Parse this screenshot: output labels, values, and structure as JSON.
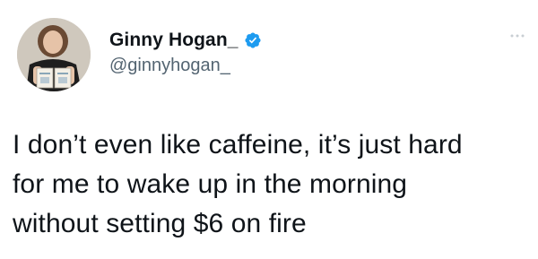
{
  "tweet": {
    "display_name": "Ginny Hogan_",
    "handle": "@ginnyhogan_",
    "verified": true,
    "text": "I don’t even like caffeine, it’s just hard\nfor me to wake up in the morning\nwithout setting $6 on fire"
  },
  "icons": {
    "avatar": "profile-photo",
    "badge": "verified-badge-icon",
    "menu": "more-options-icon"
  },
  "colors": {
    "text": "#0f1419",
    "secondary": "#536471",
    "verified": "#1d9bf0"
  }
}
